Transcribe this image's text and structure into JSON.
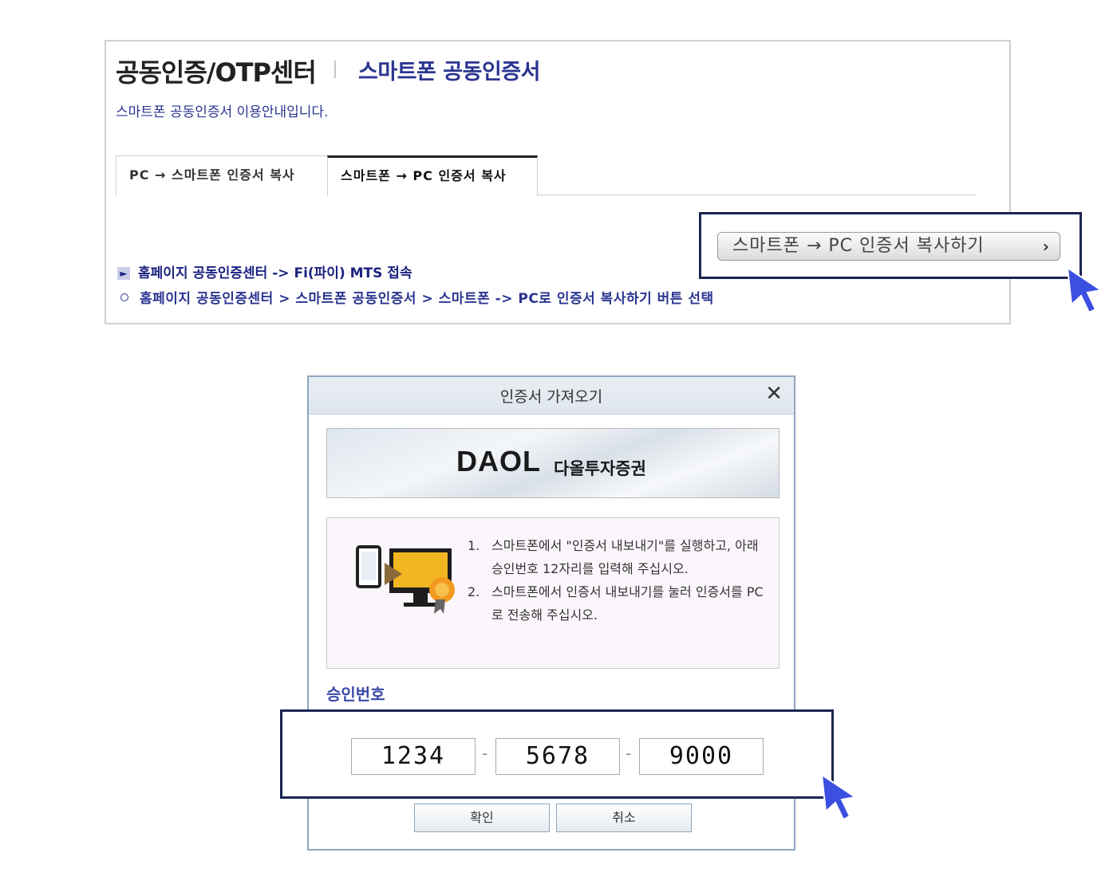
{
  "panel": {
    "title": "공동인증/OTP센터",
    "subtitle": "스마트폰 공동인증서",
    "description": "스마트폰 공동인증서 이용안내입니다.",
    "tabs": [
      {
        "label": "PC → 스마트폰 인증서 복사",
        "active": false
      },
      {
        "label": "스마트폰 → PC 인증서 복사",
        "active": true
      }
    ],
    "path_primary": "홈페이지 공동인증센터 -> Fi(파이) MTS 접속",
    "path_secondary": "홈페이지 공동인증센터 > 스마트폰 공동인증서 > 스마트폰 -> PC로 인증서 복사하기 버튼 선택",
    "copy_button": "스마트폰 → PC 인증서 복사하기",
    "copy_button_chevron": "›"
  },
  "dialog": {
    "title": "인증서 가져오기",
    "close_symbol": "✕",
    "brand": "DAOL",
    "brand_sub": "다올투자증권",
    "steps": [
      {
        "num": "1.",
        "text": "스마트폰에서 \"인증서 내보내기\"를 실행하고, 아래 승인번호 12자리를 입력해 주십시오."
      },
      {
        "num": "2.",
        "text": "스마트폰에서 인증서 내보내기를 눌러 인증서를 PC로 전송해 주십시오."
      }
    ],
    "auth_label": "승인번호",
    "codes": [
      "1234",
      "5678",
      "9000"
    ],
    "separator": "-",
    "ok_button": "확인",
    "cancel_button": "취소"
  },
  "colors": {
    "accent_navy": "#2b3590",
    "highlight_border": "#1b2550",
    "cursor": "#3b4fe0"
  },
  "icons": {
    "cursor": "pointer-cursor-icon",
    "pc_certificate": "smartphone-to-pc-certificate-icon"
  }
}
